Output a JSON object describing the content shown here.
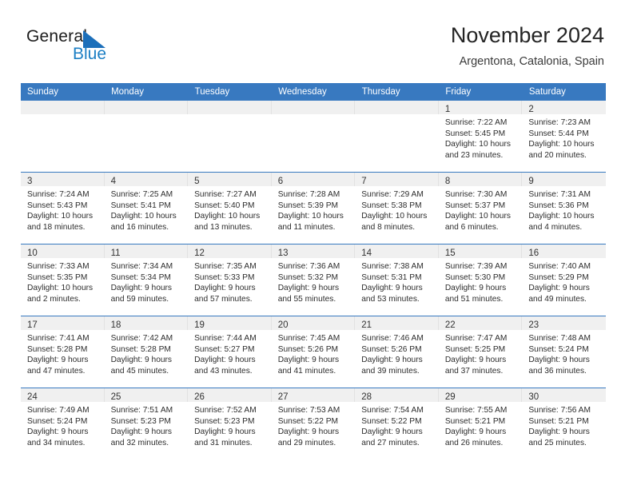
{
  "brand": {
    "name_part1": "General",
    "name_part2": "Blue",
    "triangle_color": "#1c6fba"
  },
  "header": {
    "title": "November 2024",
    "location": "Argentona, Catalonia, Spain"
  },
  "theme": {
    "header_blue": "#3879c0",
    "daynum_band": "#f0f0f0",
    "text": "#2d2d2d"
  },
  "weekdays": [
    "Sunday",
    "Monday",
    "Tuesday",
    "Wednesday",
    "Thursday",
    "Friday",
    "Saturday"
  ],
  "weeks": [
    [
      {
        "day": "",
        "sunrise": "",
        "sunset": "",
        "daylight": ""
      },
      {
        "day": "",
        "sunrise": "",
        "sunset": "",
        "daylight": ""
      },
      {
        "day": "",
        "sunrise": "",
        "sunset": "",
        "daylight": ""
      },
      {
        "day": "",
        "sunrise": "",
        "sunset": "",
        "daylight": ""
      },
      {
        "day": "",
        "sunrise": "",
        "sunset": "",
        "daylight": ""
      },
      {
        "day": "1",
        "sunrise": "Sunrise: 7:22 AM",
        "sunset": "Sunset: 5:45 PM",
        "daylight": "Daylight: 10 hours and 23 minutes."
      },
      {
        "day": "2",
        "sunrise": "Sunrise: 7:23 AM",
        "sunset": "Sunset: 5:44 PM",
        "daylight": "Daylight: 10 hours and 20 minutes."
      }
    ],
    [
      {
        "day": "3",
        "sunrise": "Sunrise: 7:24 AM",
        "sunset": "Sunset: 5:43 PM",
        "daylight": "Daylight: 10 hours and 18 minutes."
      },
      {
        "day": "4",
        "sunrise": "Sunrise: 7:25 AM",
        "sunset": "Sunset: 5:41 PM",
        "daylight": "Daylight: 10 hours and 16 minutes."
      },
      {
        "day": "5",
        "sunrise": "Sunrise: 7:27 AM",
        "sunset": "Sunset: 5:40 PM",
        "daylight": "Daylight: 10 hours and 13 minutes."
      },
      {
        "day": "6",
        "sunrise": "Sunrise: 7:28 AM",
        "sunset": "Sunset: 5:39 PM",
        "daylight": "Daylight: 10 hours and 11 minutes."
      },
      {
        "day": "7",
        "sunrise": "Sunrise: 7:29 AM",
        "sunset": "Sunset: 5:38 PM",
        "daylight": "Daylight: 10 hours and 8 minutes."
      },
      {
        "day": "8",
        "sunrise": "Sunrise: 7:30 AM",
        "sunset": "Sunset: 5:37 PM",
        "daylight": "Daylight: 10 hours and 6 minutes."
      },
      {
        "day": "9",
        "sunrise": "Sunrise: 7:31 AM",
        "sunset": "Sunset: 5:36 PM",
        "daylight": "Daylight: 10 hours and 4 minutes."
      }
    ],
    [
      {
        "day": "10",
        "sunrise": "Sunrise: 7:33 AM",
        "sunset": "Sunset: 5:35 PM",
        "daylight": "Daylight: 10 hours and 2 minutes."
      },
      {
        "day": "11",
        "sunrise": "Sunrise: 7:34 AM",
        "sunset": "Sunset: 5:34 PM",
        "daylight": "Daylight: 9 hours and 59 minutes."
      },
      {
        "day": "12",
        "sunrise": "Sunrise: 7:35 AM",
        "sunset": "Sunset: 5:33 PM",
        "daylight": "Daylight: 9 hours and 57 minutes."
      },
      {
        "day": "13",
        "sunrise": "Sunrise: 7:36 AM",
        "sunset": "Sunset: 5:32 PM",
        "daylight": "Daylight: 9 hours and 55 minutes."
      },
      {
        "day": "14",
        "sunrise": "Sunrise: 7:38 AM",
        "sunset": "Sunset: 5:31 PM",
        "daylight": "Daylight: 9 hours and 53 minutes."
      },
      {
        "day": "15",
        "sunrise": "Sunrise: 7:39 AM",
        "sunset": "Sunset: 5:30 PM",
        "daylight": "Daylight: 9 hours and 51 minutes."
      },
      {
        "day": "16",
        "sunrise": "Sunrise: 7:40 AM",
        "sunset": "Sunset: 5:29 PM",
        "daylight": "Daylight: 9 hours and 49 minutes."
      }
    ],
    [
      {
        "day": "17",
        "sunrise": "Sunrise: 7:41 AM",
        "sunset": "Sunset: 5:28 PM",
        "daylight": "Daylight: 9 hours and 47 minutes."
      },
      {
        "day": "18",
        "sunrise": "Sunrise: 7:42 AM",
        "sunset": "Sunset: 5:28 PM",
        "daylight": "Daylight: 9 hours and 45 minutes."
      },
      {
        "day": "19",
        "sunrise": "Sunrise: 7:44 AM",
        "sunset": "Sunset: 5:27 PM",
        "daylight": "Daylight: 9 hours and 43 minutes."
      },
      {
        "day": "20",
        "sunrise": "Sunrise: 7:45 AM",
        "sunset": "Sunset: 5:26 PM",
        "daylight": "Daylight: 9 hours and 41 minutes."
      },
      {
        "day": "21",
        "sunrise": "Sunrise: 7:46 AM",
        "sunset": "Sunset: 5:26 PM",
        "daylight": "Daylight: 9 hours and 39 minutes."
      },
      {
        "day": "22",
        "sunrise": "Sunrise: 7:47 AM",
        "sunset": "Sunset: 5:25 PM",
        "daylight": "Daylight: 9 hours and 37 minutes."
      },
      {
        "day": "23",
        "sunrise": "Sunrise: 7:48 AM",
        "sunset": "Sunset: 5:24 PM",
        "daylight": "Daylight: 9 hours and 36 minutes."
      }
    ],
    [
      {
        "day": "24",
        "sunrise": "Sunrise: 7:49 AM",
        "sunset": "Sunset: 5:24 PM",
        "daylight": "Daylight: 9 hours and 34 minutes."
      },
      {
        "day": "25",
        "sunrise": "Sunrise: 7:51 AM",
        "sunset": "Sunset: 5:23 PM",
        "daylight": "Daylight: 9 hours and 32 minutes."
      },
      {
        "day": "26",
        "sunrise": "Sunrise: 7:52 AM",
        "sunset": "Sunset: 5:23 PM",
        "daylight": "Daylight: 9 hours and 31 minutes."
      },
      {
        "day": "27",
        "sunrise": "Sunrise: 7:53 AM",
        "sunset": "Sunset: 5:22 PM",
        "daylight": "Daylight: 9 hours and 29 minutes."
      },
      {
        "day": "28",
        "sunrise": "Sunrise: 7:54 AM",
        "sunset": "Sunset: 5:22 PM",
        "daylight": "Daylight: 9 hours and 27 minutes."
      },
      {
        "day": "29",
        "sunrise": "Sunrise: 7:55 AM",
        "sunset": "Sunset: 5:21 PM",
        "daylight": "Daylight: 9 hours and 26 minutes."
      },
      {
        "day": "30",
        "sunrise": "Sunrise: 7:56 AM",
        "sunset": "Sunset: 5:21 PM",
        "daylight": "Daylight: 9 hours and 25 minutes."
      }
    ]
  ]
}
